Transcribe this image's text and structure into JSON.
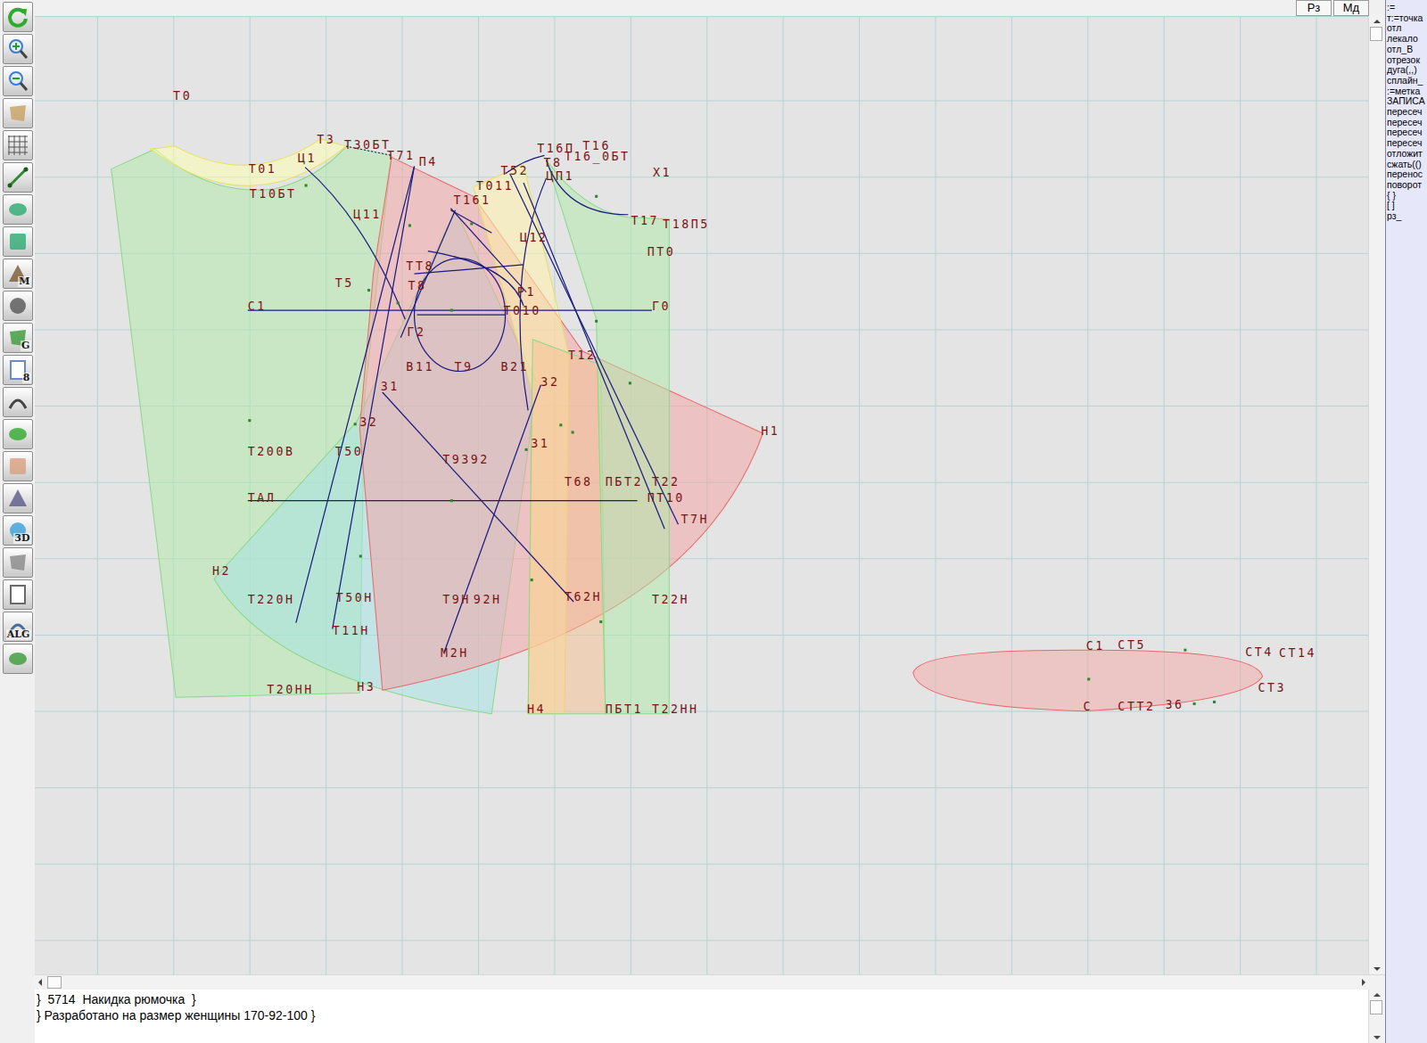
{
  "window": {
    "title": "Накидка рюмочка"
  },
  "top_buttons": [
    {
      "label": "Рз"
    },
    {
      "label": "Мд"
    }
  ],
  "toolbar": [
    "",
    "",
    "",
    "",
    "",
    "",
    "",
    "",
    "M",
    "",
    "G",
    "8",
    "",
    "",
    "",
    "",
    "3D",
    "",
    "",
    "ALG",
    ""
  ],
  "commands": [
    ":=",
    "т:=точка",
    "отл",
    "лекало",
    "отл_В",
    "отрезок",
    "дуга(,,)",
    "сплайн_",
    ":=метка",
    "ЗАПИСА",
    "пересеч",
    "пересеч",
    "пересеч",
    "пересеч",
    "отложит",
    "сжать(()",
    "перенос",
    "поворот",
    "{ }",
    "[ ]",
    "рз_"
  ],
  "pieces": [
    {
      "color": "#b4eaac"
    },
    {
      "color": "#ffffb4"
    },
    {
      "color": "#a6e4e4"
    },
    {
      "color": "#f2a6a6"
    },
    {
      "color": "#fff2aa"
    },
    {
      "color": "#f4c296"
    },
    {
      "color": "#b4eaac"
    },
    {
      "color": "#f2acac"
    }
  ],
  "labels": [
    {
      "text": "Т0"
    },
    {
      "text": "Т3"
    },
    {
      "text": "Т30БТ"
    },
    {
      "text": "Ц1"
    },
    {
      "text": "Т01"
    },
    {
      "text": "Т10БТ"
    },
    {
      "text": "Т71"
    },
    {
      "text": "П4"
    },
    {
      "text": "Ц11"
    },
    {
      "text": "Т16П"
    },
    {
      "text": "Т16"
    },
    {
      "text": "Т16_0БТ"
    },
    {
      "text": "Т8"
    },
    {
      "text": "Т52"
    },
    {
      "text": "Х1"
    },
    {
      "text": "ЦП1"
    },
    {
      "text": "Т011"
    },
    {
      "text": "Т161"
    },
    {
      "text": "Т17"
    },
    {
      "text": "Т18П5"
    },
    {
      "text": "ПТ0"
    },
    {
      "text": "Ц12"
    },
    {
      "text": "Т5"
    },
    {
      "text": "ТТ8"
    },
    {
      "text": "Т8"
    },
    {
      "text": "Р1"
    },
    {
      "text": "С1"
    },
    {
      "text": "Г0"
    },
    {
      "text": "Т010"
    },
    {
      "text": "Г2"
    },
    {
      "text": "В11"
    },
    {
      "text": "Т9"
    },
    {
      "text": "В21"
    },
    {
      "text": "Т12"
    },
    {
      "text": "Н1"
    },
    {
      "text": "З2"
    },
    {
      "text": "З1"
    },
    {
      "text": "З2"
    },
    {
      "text": "Т200В"
    },
    {
      "text": "Т50"
    },
    {
      "text": "Т9З92"
    },
    {
      "text": "З1"
    },
    {
      "text": "Т68"
    },
    {
      "text": "ПБТ2"
    },
    {
      "text": "Т22"
    },
    {
      "text": "ПТ10"
    },
    {
      "text": "ТАЛ"
    },
    {
      "text": "Т7Н"
    },
    {
      "text": "Н2"
    },
    {
      "text": "Т220Н"
    },
    {
      "text": "Т50Н"
    },
    {
      "text": "Т9Н"
    },
    {
      "text": "92Н"
    },
    {
      "text": "Т62Н"
    },
    {
      "text": "Т22Н"
    },
    {
      "text": "Т11Н"
    },
    {
      "text": "М2Н"
    },
    {
      "text": "Т20НН"
    },
    {
      "text": "Н3"
    },
    {
      "text": "Н4"
    },
    {
      "text": "ПБТ1"
    },
    {
      "text": "Т22НН"
    },
    {
      "text": "С1"
    },
    {
      "text": "СТ5"
    },
    {
      "text": "СТ4"
    },
    {
      "text": "СТ14"
    },
    {
      "text": "СТ3"
    },
    {
      "text": "С"
    },
    {
      "text": "СТТ2"
    },
    {
      "text": "З6"
    }
  ],
  "notes": [
    "}  5714  Накидка рюмочка  }",
    "} Разработано на размер женщины 170-92-100 }"
  ]
}
